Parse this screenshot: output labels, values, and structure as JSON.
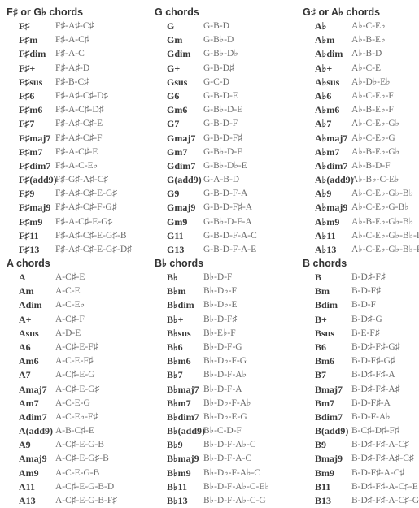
{
  "sections": [
    {
      "title": "F♯ or G♭ chords",
      "chords": [
        [
          "F♯",
          "F♯-A♯-C♯"
        ],
        [
          "F♯m",
          "F♯-A-C♯"
        ],
        [
          "F♯dim",
          "F♯-A-C"
        ],
        [
          "F♯+",
          "F♯-A♯-D"
        ],
        [
          "F♯sus",
          "F♯-B-C♯"
        ],
        [
          "F♯6",
          "F♯-A♯-C♯-D♯"
        ],
        [
          "F♯m6",
          "F♯-A-C♯-D♯"
        ],
        [
          "F♯7",
          "F♯-A♯-C♯-E"
        ],
        [
          "F♯maj7",
          "F♯-A♯-C♯-F"
        ],
        [
          "F♯m7",
          "F♯-A-C♯-E"
        ],
        [
          "F♯dim7",
          "F♯-A-C-E♭"
        ],
        [
          "F♯(add9)",
          "F♯-G♯-A♯-C♯"
        ],
        [
          "F♯9",
          "F♯-A♯-C♯-E-G♯"
        ],
        [
          "F♯maj9",
          "F♯-A♯-C♯-F-G♯"
        ],
        [
          "F♯m9",
          "F♯-A-C♯-E-G♯"
        ],
        [
          "F♯11",
          "F♯-A♯-C♯-E-G♯-B"
        ],
        [
          "F♯13",
          "F♯-A♯-C♯-E-G♯-D♯"
        ]
      ]
    },
    {
      "title": "G chords",
      "chords": [
        [
          "G",
          "G-B-D"
        ],
        [
          "Gm",
          "G-B♭-D"
        ],
        [
          "Gdim",
          "G-B♭-D♭"
        ],
        [
          "G+",
          "G-B-D♯"
        ],
        [
          "Gsus",
          "G-C-D"
        ],
        [
          "G6",
          "G-B-D-E"
        ],
        [
          "Gm6",
          "G-B♭-D-E"
        ],
        [
          "G7",
          "G-B-D-F"
        ],
        [
          "Gmaj7",
          "G-B-D-F♯"
        ],
        [
          "Gm7",
          "G-B♭-D-F"
        ],
        [
          "Gdim7",
          "G-B♭-D♭-E"
        ],
        [
          "G(add9)",
          "G-A-B-D"
        ],
        [
          "G9",
          "G-B-D-F-A"
        ],
        [
          "Gmaj9",
          "G-B-D-F♯-A"
        ],
        [
          "Gm9",
          "G-B♭-D-F-A"
        ],
        [
          "G11",
          "G-B-D-F-A-C"
        ],
        [
          "G13",
          "G-B-D-F-A-E"
        ]
      ]
    },
    {
      "title": "G♯ or A♭ chords",
      "chords": [
        [
          "A♭",
          "A♭-C-E♭"
        ],
        [
          "A♭m",
          "A♭-B-E♭"
        ],
        [
          "A♭dim",
          "A♭-B-D"
        ],
        [
          "A♭+",
          "A♭-C-E"
        ],
        [
          "A♭sus",
          "A♭-D♭-E♭"
        ],
        [
          "A♭6",
          "A♭-C-E♭-F"
        ],
        [
          "A♭m6",
          "A♭-B-E♭-F"
        ],
        [
          "A♭7",
          "A♭-C-E♭-G♭"
        ],
        [
          "A♭maj7",
          "A♭-C-E♭-G"
        ],
        [
          "A♭m7",
          "A♭-B-E♭-G♭"
        ],
        [
          "A♭dim7",
          "A♭-B-D-F"
        ],
        [
          "A♭(add9)",
          "A♭-B♭-C-E♭"
        ],
        [
          "A♭9",
          "A♭-C-E♭-G♭-B♭"
        ],
        [
          "A♭maj9",
          "A♭-C-E♭-G-B♭"
        ],
        [
          "A♭m9",
          "A♭-B-E♭-G♭-B♭"
        ],
        [
          "A♭11",
          "A♭-C-E♭-G♭-B♭-D♭"
        ],
        [
          "A♭13",
          "A♭-C-E♭-G♭-B♭-F"
        ]
      ]
    },
    {
      "title": "A chords",
      "chords": [
        [
          "A",
          "A-C♯-E"
        ],
        [
          "Am",
          "A-C-E"
        ],
        [
          "Adim",
          "A-C-E♭"
        ],
        [
          "A+",
          "A-C♯-F"
        ],
        [
          "Asus",
          "A-D-E"
        ],
        [
          "A6",
          "A-C♯-E-F♯"
        ],
        [
          "Am6",
          "A-C-E-F♯"
        ],
        [
          "A7",
          "A-C♯-E-G"
        ],
        [
          "Amaj7",
          "A-C♯-E-G♯"
        ],
        [
          "Am7",
          "A-C-E-G"
        ],
        [
          "Adim7",
          "A-C-E♭-F♯"
        ],
        [
          "A(add9)",
          "A-B-C♯-E"
        ],
        [
          "A9",
          "A-C♯-E-G-B"
        ],
        [
          "Amaj9",
          "A-C♯-E-G♯-B"
        ],
        [
          "Am9",
          "A-C-E-G-B"
        ],
        [
          "A11",
          "A-C♯-E-G-B-D"
        ],
        [
          "A13",
          "A-C♯-E-G-B-F♯"
        ]
      ]
    },
    {
      "title": "B♭ chords",
      "chords": [
        [
          "B♭",
          "B♭-D-F"
        ],
        [
          "B♭m",
          "B♭-D♭-F"
        ],
        [
          "B♭dim",
          "B♭-D♭-E"
        ],
        [
          "B♭+",
          "B♭-D-F♯"
        ],
        [
          "B♭sus",
          "B♭-E♭-F"
        ],
        [
          "B♭6",
          "B♭-D-F-G"
        ],
        [
          "B♭m6",
          "B♭-D♭-F-G"
        ],
        [
          "B♭7",
          "B♭-D-F-A♭"
        ],
        [
          "B♭maj7",
          "B♭-D-F-A"
        ],
        [
          "B♭m7",
          "B♭-D♭-F-A♭"
        ],
        [
          "B♭dim7",
          "B♭-D♭-E-G"
        ],
        [
          "B♭(add9)",
          "B♭-C-D-F"
        ],
        [
          "B♭9",
          "B♭-D-F-A♭-C"
        ],
        [
          "B♭maj9",
          "B♭-D-F-A-C"
        ],
        [
          "B♭m9",
          "B♭-D♭-F-A♭-C"
        ],
        [
          "B♭11",
          "B♭-D-F-A♭-C-E♭"
        ],
        [
          "B♭13",
          "B♭-D-F-A♭-C-G"
        ]
      ]
    },
    {
      "title": "B chords",
      "chords": [
        [
          "B",
          "B-D♯-F♯"
        ],
        [
          "Bm",
          "B-D-F♯"
        ],
        [
          "Bdim",
          "B-D-F"
        ],
        [
          "B+",
          "B-D♯-G"
        ],
        [
          "Bsus",
          "B-E-F♯"
        ],
        [
          "B6",
          "B-D♯-F♯-G♯"
        ],
        [
          "Bm6",
          "B-D-F♯-G♯"
        ],
        [
          "B7",
          "B-D♯-F♯-A"
        ],
        [
          "Bmaj7",
          "B-D♯-F♯-A♯"
        ],
        [
          "Bm7",
          "B-D-F♯-A"
        ],
        [
          "Bdim7",
          "B-D-F-A♭"
        ],
        [
          "B(add9)",
          "B-C♯-D♯-F♯"
        ],
        [
          "B9",
          "B-D♯-F♯-A-C♯"
        ],
        [
          "Bmaj9",
          "B-D♯-F♯-A♯-C♯"
        ],
        [
          "Bm9",
          "B-D-F♯-A-C♯"
        ],
        [
          "B11",
          "B-D♯-F♯-A-C♯-E"
        ],
        [
          "B13",
          "B-D♯-F♯-A-C♯-G♯"
        ]
      ]
    }
  ]
}
